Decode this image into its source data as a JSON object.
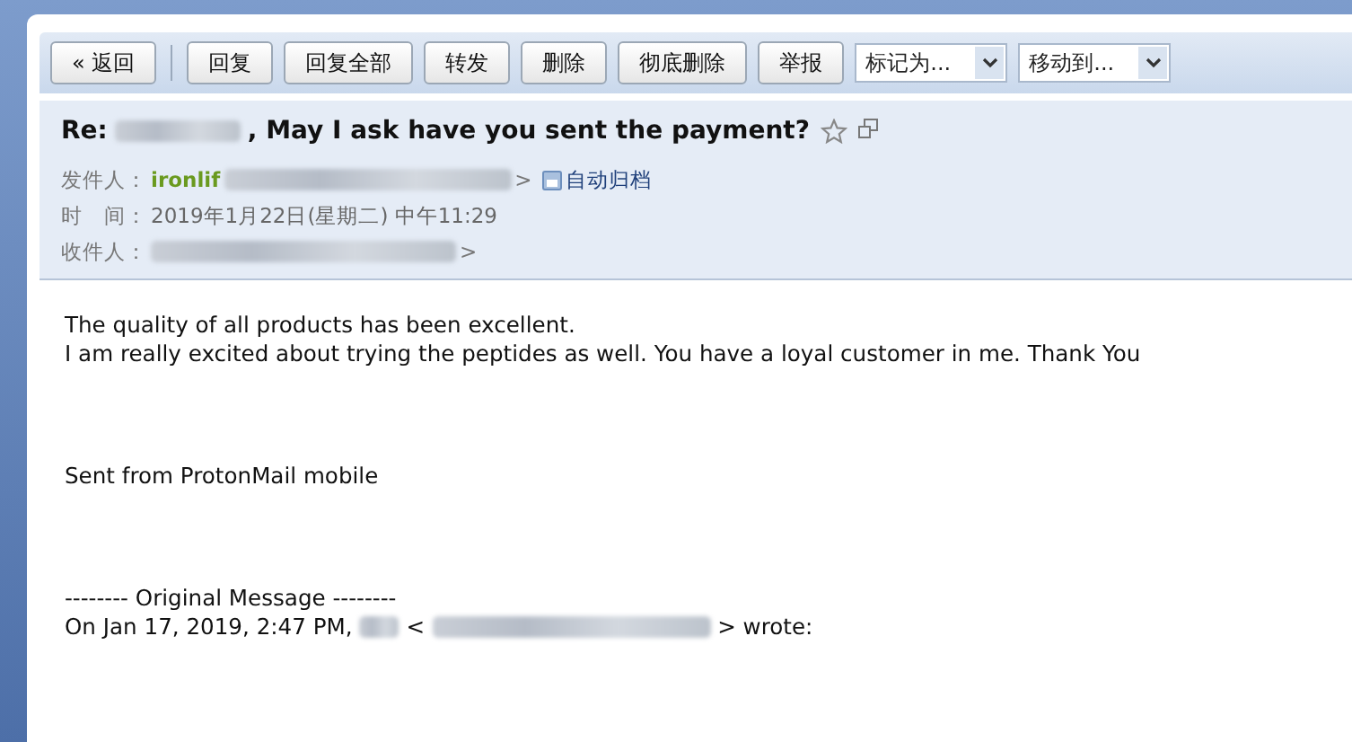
{
  "toolbar": {
    "buttons": [
      {
        "label": "« 返回",
        "kind": "back"
      },
      {
        "label": "回复",
        "kind": "action"
      },
      {
        "label": "回复全部",
        "kind": "action"
      },
      {
        "label": "转发",
        "kind": "action"
      },
      {
        "label": "删除",
        "kind": "action"
      },
      {
        "label": "彻底删除",
        "kind": "action"
      },
      {
        "label": "举报",
        "kind": "action"
      }
    ],
    "dropdowns": [
      {
        "value": "标记为..."
      },
      {
        "value": "移动到..."
      }
    ]
  },
  "header": {
    "subject_prefix": "Re:",
    "subject": ", May I ask have you sent the payment?",
    "from_label": "发件人：",
    "from_name": "ironlif",
    "from_suffix": ">",
    "auto_archive": "自动归档",
    "time_label": "时　间：",
    "time": "2019年1月22日(星期二) 中午11:29",
    "to_label": "收件人：",
    "to_suffix": ">"
  },
  "body": {
    "lines": [
      "The quality of all products has been excellent.",
      "I am really excited about trying the peptides as well. You have a loyal customer in me. Thank You"
    ],
    "signature": "Sent from ProtonMail mobile",
    "original_header": "-------- Original Message --------",
    "quote_prefix": "On Jan 17, 2019, 2:47 PM,",
    "quote_mid": "<",
    "quote_suffix": "> wrote:"
  }
}
